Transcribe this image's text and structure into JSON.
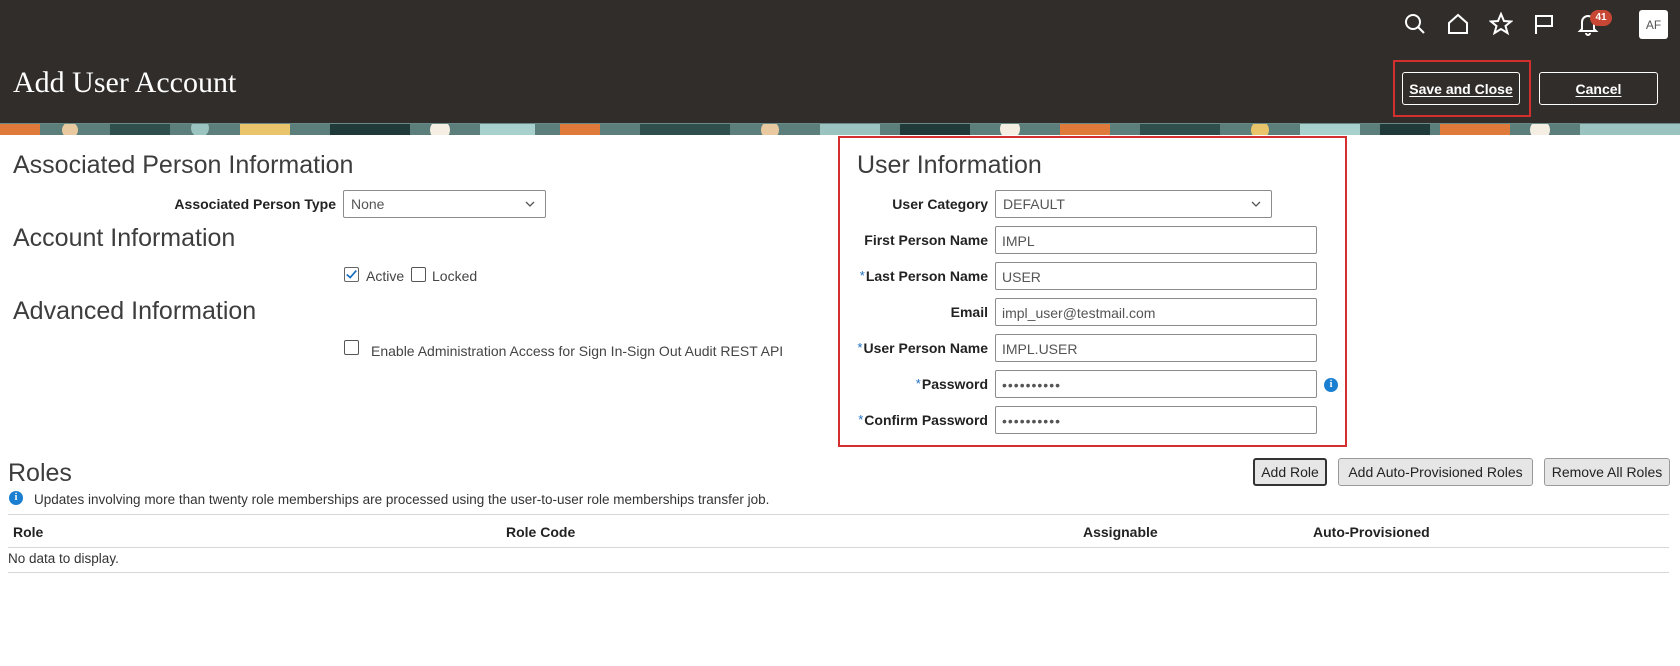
{
  "page": {
    "title": "Add User Account"
  },
  "header": {
    "notification_count": "41",
    "avatar_initials": "AF",
    "save_close_label": "Save and Close",
    "cancel_label": "Cancel"
  },
  "associated_person": {
    "heading": "Associated Person Information",
    "type_label": "Associated Person Type",
    "type_value": "None"
  },
  "account": {
    "heading": "Account Information",
    "active_label": "Active",
    "active_checked": true,
    "locked_label": "Locked",
    "locked_checked": false
  },
  "advanced": {
    "heading": "Advanced Information",
    "audit_label": "Enable Administration Access for Sign In-Sign Out Audit REST API",
    "audit_checked": false
  },
  "user_info": {
    "heading": "User Information",
    "user_category_label": "User Category",
    "user_category_value": "DEFAULT",
    "first_name_label": "First Person Name",
    "first_name_value": "IMPL",
    "last_name_label": "Last Person Name",
    "last_name_value": "USER",
    "email_label": "Email",
    "email_value": "impl_user@testmail.com",
    "user_name_label": "User Person Name",
    "user_name_value": "IMPL.USER",
    "password_label": "Password",
    "password_value": "••••••••••",
    "confirm_password_label": "Confirm Password",
    "confirm_password_value": "••••••••••",
    "required_marker": "*"
  },
  "roles": {
    "heading": "Roles",
    "note": "Updates involving more than twenty role memberships are processed using the user-to-user role memberships transfer job.",
    "add_role_label": "Add Role",
    "add_auto_label": "Add Auto-Provisioned Roles",
    "remove_all_label": "Remove All Roles",
    "columns": [
      "Role",
      "Role Code",
      "Assignable",
      "Auto-Provisioned"
    ],
    "empty_text": "No data to display."
  },
  "icons": {
    "search": "search-icon",
    "home": "home-icon",
    "favorites": "star-icon",
    "flag": "flag-icon",
    "notifications": "bell-icon",
    "info": "info-icon",
    "chevron": "chevron-down-icon"
  },
  "colors": {
    "header_bg": "#312d2a",
    "highlight": "#d32f2f",
    "badge": "#c74634",
    "info": "#1a7fd0",
    "required": "#1a6fbf"
  }
}
